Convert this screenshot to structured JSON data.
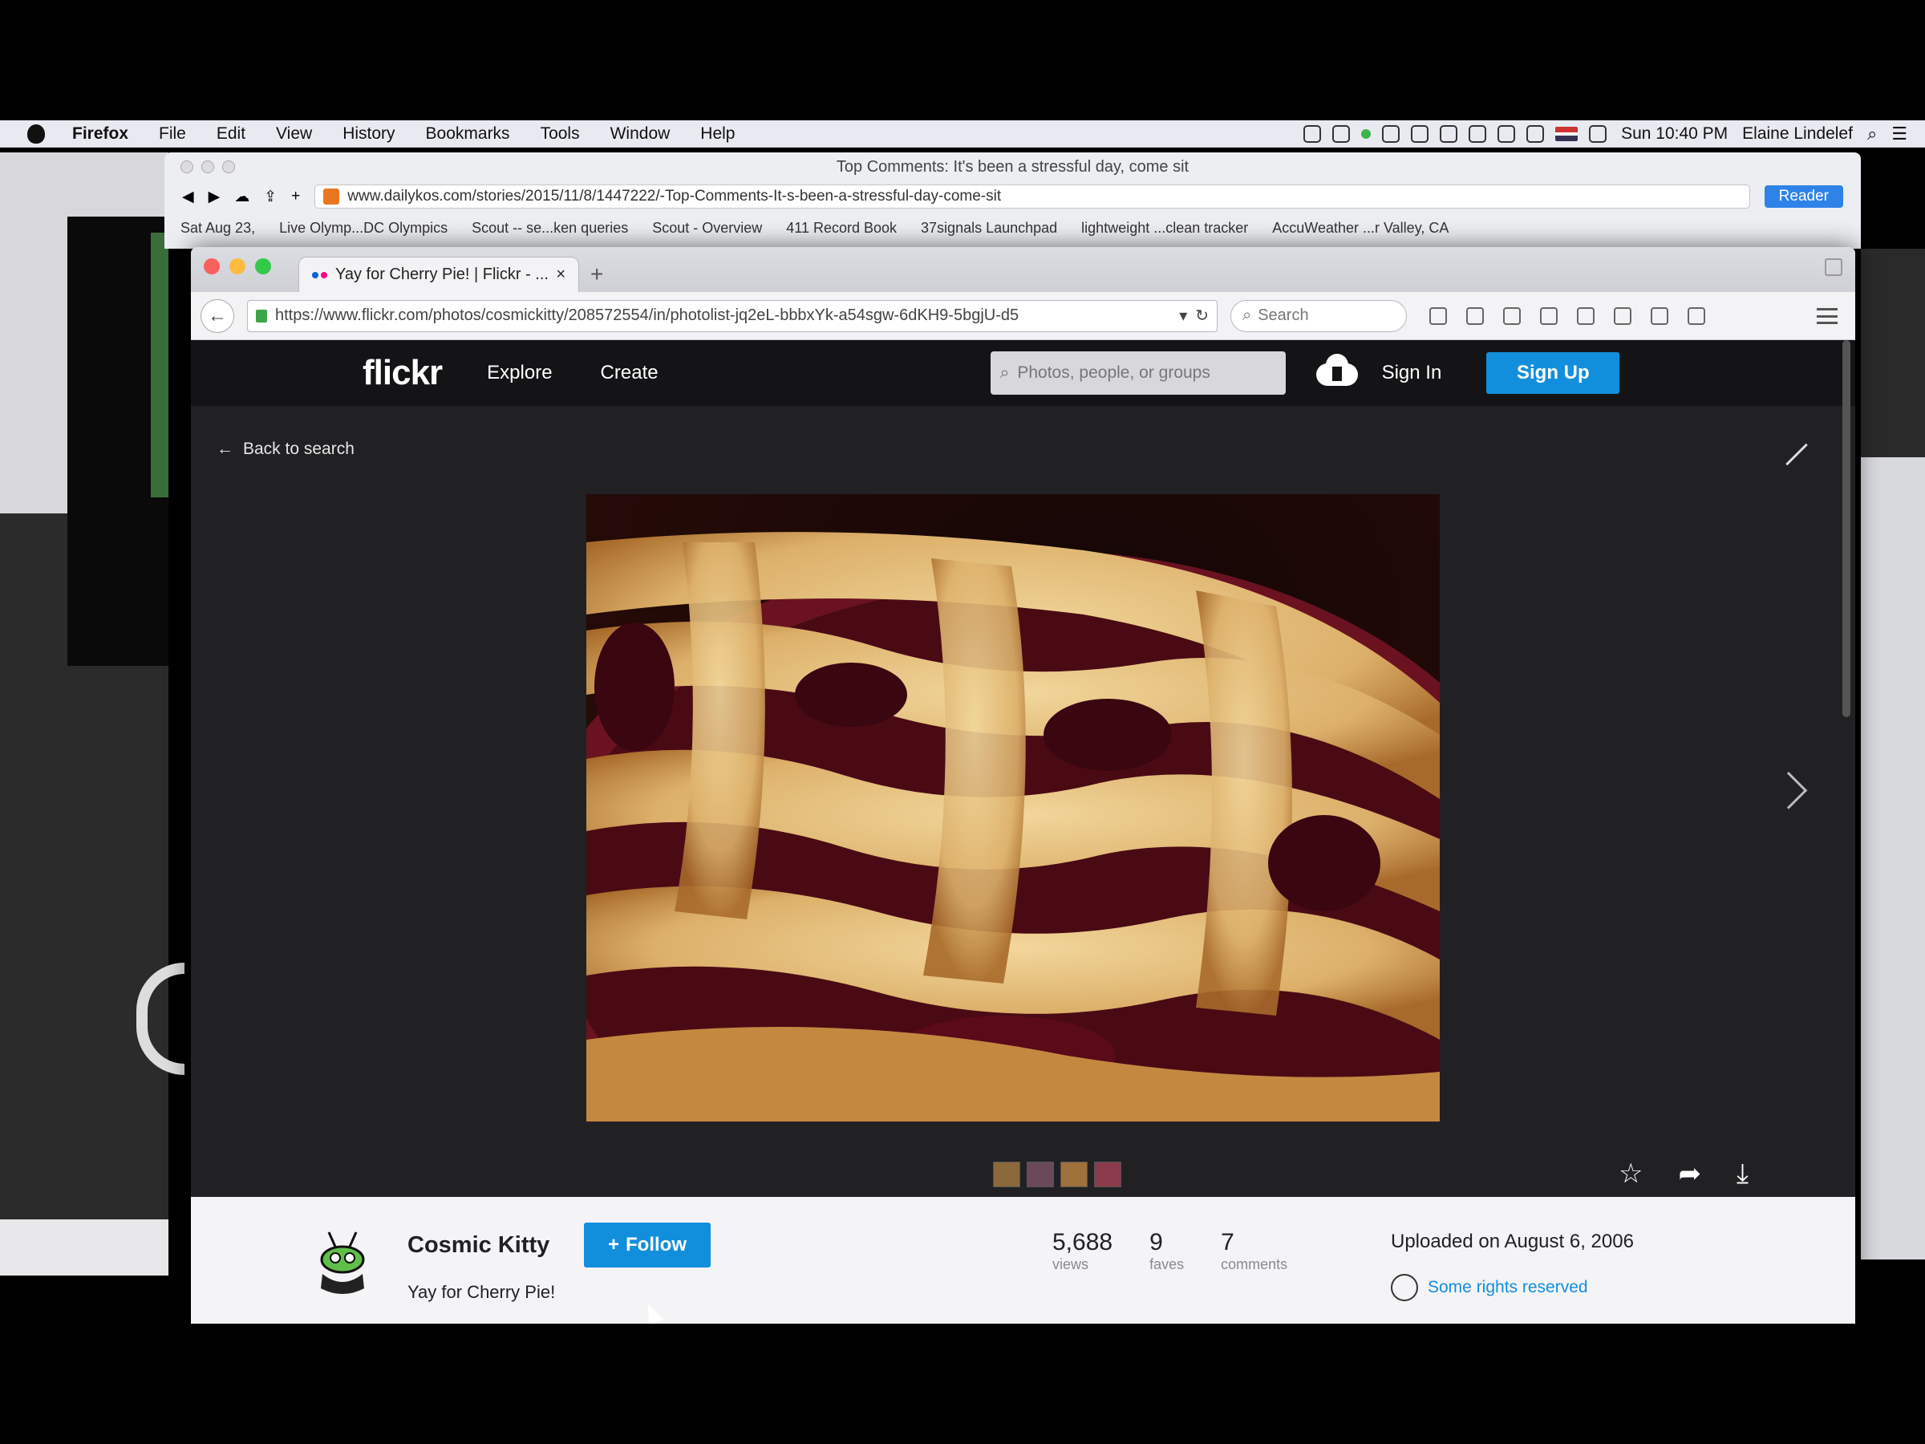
{
  "menubar": {
    "app": "Firefox",
    "items": [
      "File",
      "Edit",
      "View",
      "History",
      "Bookmarks",
      "Tools",
      "Window",
      "Help"
    ],
    "clock": "Sun 10:40 PM",
    "user": "Elaine Lindelef"
  },
  "back_window": {
    "title": "Top Comments: It's been a stressful day, come sit",
    "url": "www.dailykos.com/stories/2015/11/8/1447222/-Top-Comments-It-s-been-a-stressful-day-come-sit",
    "reader_label": "Reader",
    "bookmarks": [
      "Sat Aug 23,",
      "Live Olymp...DC Olympics",
      "Scout -- se...ken queries",
      "Scout - Overview",
      "411 Record Book",
      "37signals Launchpad",
      "lightweight ...clean tracker",
      "AccuWeather ...r Valley, CA"
    ]
  },
  "browser": {
    "tab_title": "Yay for Cherry Pie! | Flickr - ...",
    "url": "https://www.flickr.com/photos/cosmickitty/208572554/in/photolist-jq2eL-bbbxYk-a54sgw-6dKH9-5bgjU-d5",
    "search_placeholder": "Search"
  },
  "flickr": {
    "logo": "flickr",
    "nav": [
      "Explore",
      "Create"
    ],
    "search_placeholder": "Photos, people, or groups",
    "sign_in": "Sign In",
    "sign_up": "Sign Up",
    "back_to_search": "Back to search",
    "author": "Cosmic Kitty",
    "follow_label": "Follow",
    "photo_title": "Yay for Cherry Pie!",
    "stats": [
      {
        "value": "5,688",
        "label": "views"
      },
      {
        "value": "9",
        "label": "faves"
      },
      {
        "value": "7",
        "label": "comments"
      }
    ],
    "uploaded": "Uploaded on August 6, 2006",
    "rights": "Some rights reserved"
  },
  "colors": {
    "flickr_blue": "#128fdc",
    "flickr_dark": "#212124",
    "header_dark": "#141416",
    "flickr_pink": "#ff0084"
  },
  "icons": [
    "apple-icon",
    "search-icon",
    "upload-cloud-icon",
    "arrow-left-icon",
    "expand-icon",
    "chevron-right-icon",
    "star-icon",
    "share-icon",
    "download-icon",
    "creative-commons-icon",
    "lock-icon"
  ]
}
